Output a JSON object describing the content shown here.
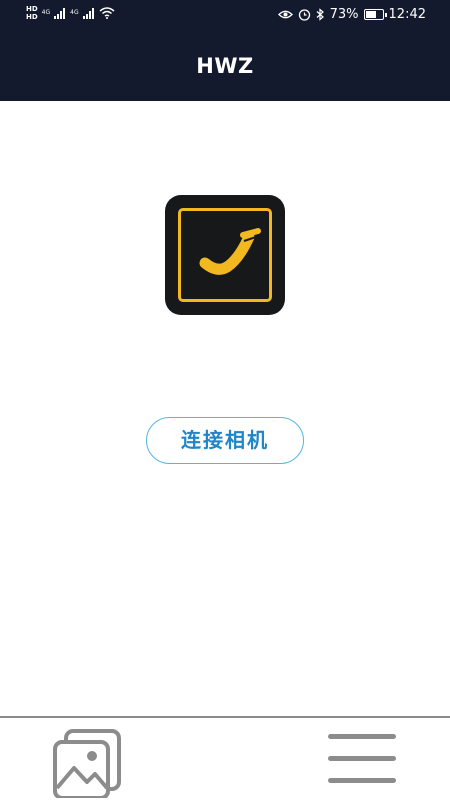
{
  "status_bar": {
    "hd_badge_1": "HD",
    "hd_badge_2": "HD",
    "network_1": "4G",
    "network_2": "4G",
    "battery_percent": "73%",
    "battery_level": 0.73,
    "time": "12:42"
  },
  "header": {
    "title": "HWZ"
  },
  "main": {
    "connect_button_label": "连接相机"
  },
  "bottom_nav": {
    "gallery_icon": "gallery-icon",
    "menu_icon": "menu-icon"
  },
  "colors": {
    "header_bg": "#141a2e",
    "logo_bg": "#17181a",
    "logo_accent": "#f2b820",
    "button_border": "#55b6e0",
    "button_text": "#1f86c8",
    "nav_icon": "#8c8c8c"
  }
}
